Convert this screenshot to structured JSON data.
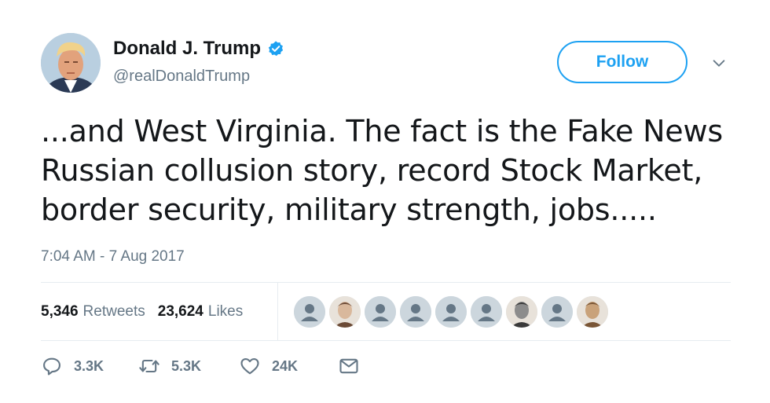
{
  "tweet": {
    "author": {
      "name": "Donald J. Trump",
      "handle": "@realDonaldTrump",
      "verified": true,
      "avatar": "profile-photo"
    },
    "follow_label": "Follow",
    "text_lines": [
      "...and West Virginia. The fact is the Fake News",
      "Russian collusion story, record Stock Market,",
      "border security, military strength, jobs....."
    ],
    "timestamp": "7:04 AM - 7 Aug 2017",
    "stats": {
      "retweets_count": "5,346",
      "retweets_label": "Retweets",
      "likes_count": "23,624",
      "likes_label": "Likes"
    },
    "likers": [
      "default",
      "photo",
      "default",
      "default",
      "default",
      "default",
      "photo",
      "default",
      "photo"
    ],
    "actions": {
      "reply_count": "3.3K",
      "retweet_count": "5.3K",
      "like_count": "24K"
    }
  },
  "colors": {
    "brand_blue": "#1da1f2",
    "text": "#14171a",
    "secondary": "#657786",
    "divider": "#e6ecf0"
  }
}
